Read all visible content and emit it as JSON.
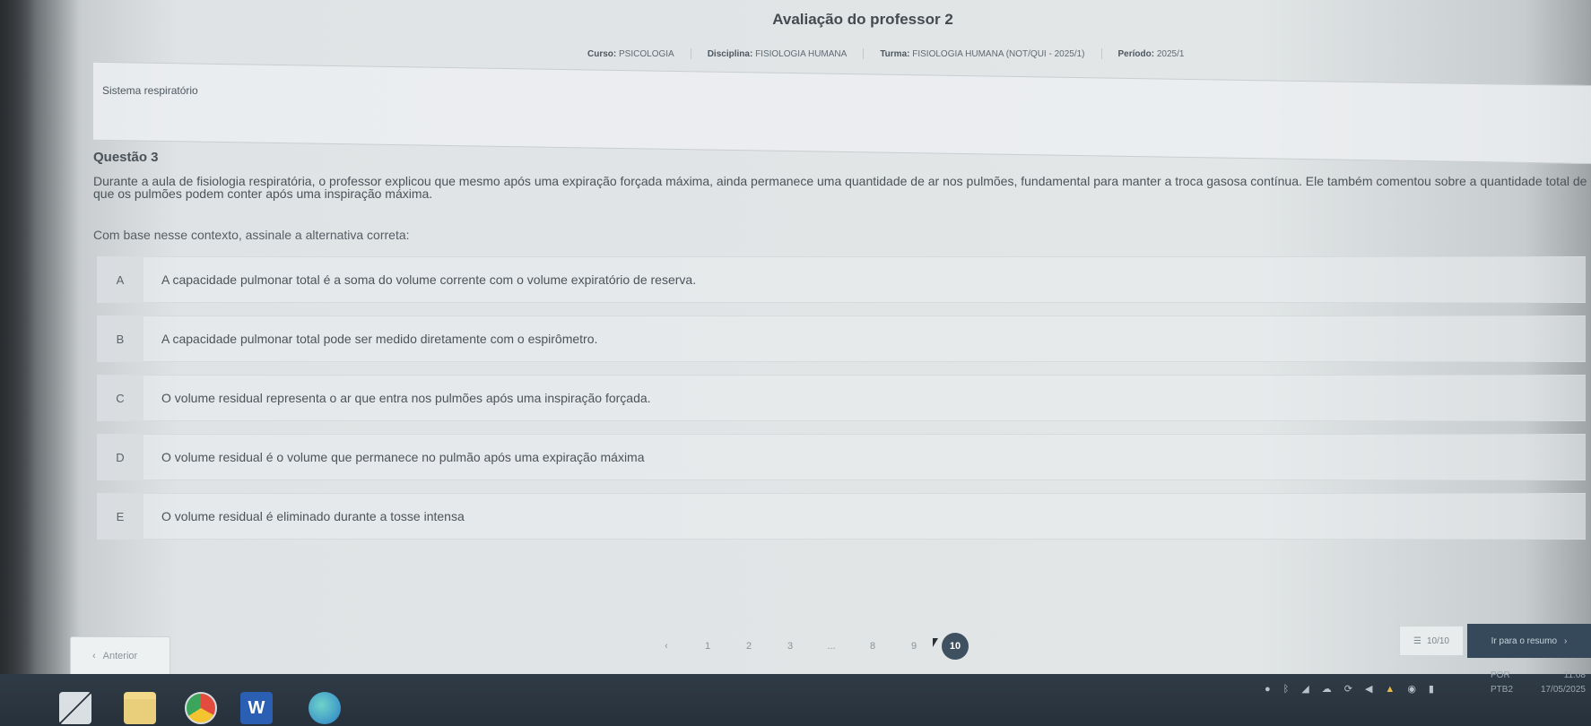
{
  "header": {
    "title": "Avaliação do professor 2",
    "meta": [
      {
        "label": "Curso:",
        "value": "PSICOLOGIA"
      },
      {
        "label": "Disciplina:",
        "value": "FISIOLOGIA HUMANA"
      },
      {
        "label": "Turma:",
        "value": "FISIOLOGIA HUMANA (NOT/QUI - 2025/1)"
      },
      {
        "label": "Período:",
        "value": "2025/1"
      }
    ]
  },
  "topic": "Sistema respiratório",
  "question": {
    "number": "Questão 3",
    "stem": "Durante a aula de fisiologia respiratória, o professor explicou que mesmo após uma expiração forçada máxima, ainda permanece uma quantidade de ar nos pulmões, fundamental para manter a troca gasosa contínua. Ele também comentou sobre a quantidade total de ar que os pulmões podem conter após uma inspiração máxima.",
    "prompt": "Com base nesse contexto, assinale a alternativa correta:",
    "options": [
      {
        "letter": "A",
        "text": "A capacidade pulmonar total é a soma do volume corrente com o volume expiratório de reserva."
      },
      {
        "letter": "B",
        "text": "A capacidade pulmonar total pode ser medido diretamente com o espirômetro."
      },
      {
        "letter": "C",
        "text": "O volume residual representa o ar que entra nos pulmões após uma inspiração forçada."
      },
      {
        "letter": "D",
        "text": "O volume residual é o volume que permanece no pulmão após uma expiração máxima"
      },
      {
        "letter": "E",
        "text": "O volume residual é eliminado durante a tosse intensa"
      }
    ]
  },
  "navigation": {
    "prev_label": "Anterior",
    "prev_icon": "chevron-left-icon",
    "pages": [
      "‹",
      "1",
      "2",
      "3",
      "...",
      "8",
      "9",
      "10"
    ],
    "active_page": "10",
    "progress_label": "10/10",
    "summary_label": "Ir para o resumo",
    "summary_icon": "chevron-right-icon"
  },
  "taskbar": {
    "apps": [
      "windows-start",
      "file-explorer",
      "chrome",
      "word",
      "edge"
    ],
    "lang_top": "POR",
    "lang_bottom": "PTB2",
    "time": "11:08",
    "date": "17/05/2025"
  },
  "colors": {
    "accent": "#3f5161",
    "summary_bg": "#36495a",
    "taskbar": "#2f3b46"
  }
}
